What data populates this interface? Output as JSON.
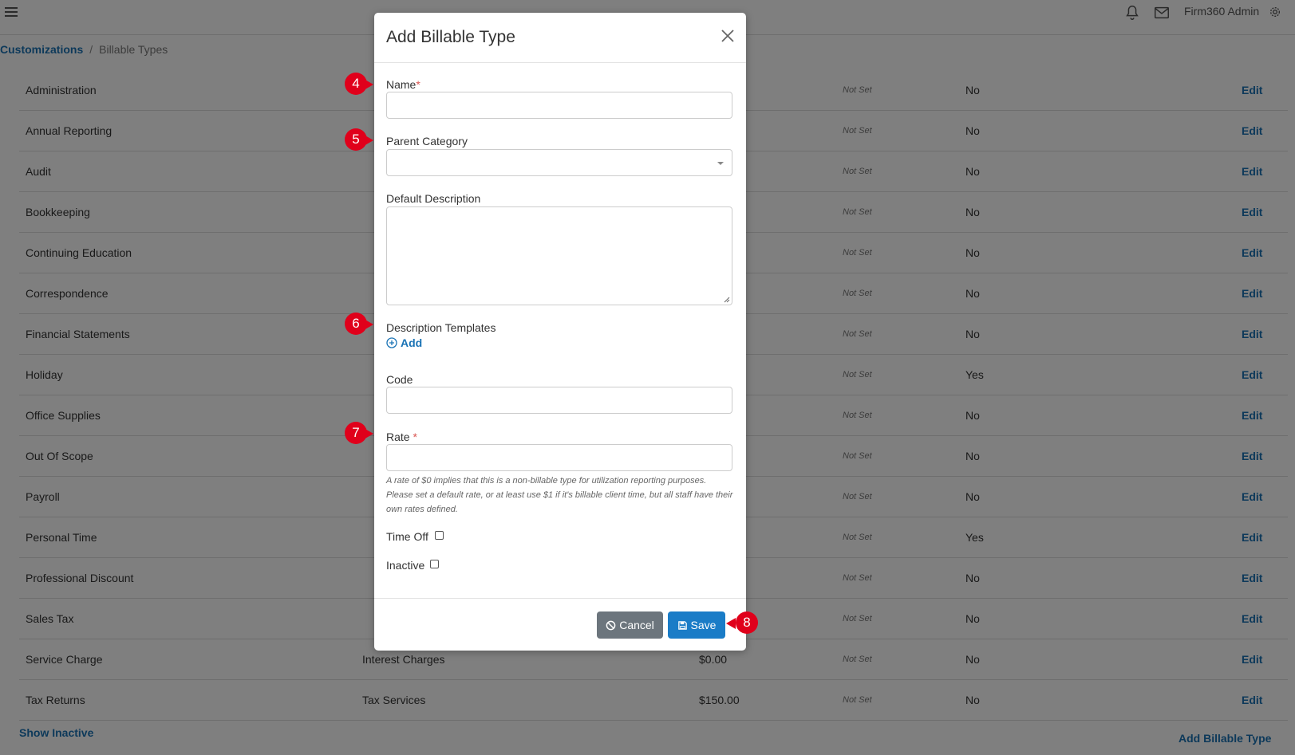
{
  "topbar": {
    "user": "Firm360 Admin",
    "icons": [
      "menu-icon",
      "bell-icon",
      "mail-icon",
      "gear-icon"
    ]
  },
  "breadcrumb": {
    "parent": "Customizations",
    "sep": "/",
    "current": "Billable Types"
  },
  "table": {
    "rows": [
      {
        "name": "Administration",
        "parent": "",
        "rate": "",
        "default": "Not Set",
        "time_off": "No",
        "action": "Edit"
      },
      {
        "name": "Annual Reporting",
        "parent": "",
        "rate": "",
        "default": "Not Set",
        "time_off": "No",
        "action": "Edit"
      },
      {
        "name": "Audit",
        "parent": "",
        "rate": "",
        "default": "Not Set",
        "time_off": "No",
        "action": "Edit"
      },
      {
        "name": "Bookkeeping",
        "parent": "",
        "rate": "",
        "default": "Not Set",
        "time_off": "No",
        "action": "Edit"
      },
      {
        "name": "Continuing Education",
        "parent": "",
        "rate": "",
        "default": "Not Set",
        "time_off": "No",
        "action": "Edit"
      },
      {
        "name": "Correspondence",
        "parent": "",
        "rate": "",
        "default": "Not Set",
        "time_off": "No",
        "action": "Edit"
      },
      {
        "name": "Financial Statements",
        "parent": "",
        "rate": "",
        "default": "Not Set",
        "time_off": "No",
        "action": "Edit"
      },
      {
        "name": "Holiday",
        "parent": "",
        "rate": "",
        "default": "Not Set",
        "time_off": "Yes",
        "action": "Edit"
      },
      {
        "name": "Office Supplies",
        "parent": "",
        "rate": "",
        "default": "Not Set",
        "time_off": "No",
        "action": "Edit"
      },
      {
        "name": "Out Of Scope",
        "parent": "",
        "rate": "",
        "default": "Not Set",
        "time_off": "No",
        "action": "Edit"
      },
      {
        "name": "Payroll",
        "parent": "",
        "rate": "",
        "default": "Not Set",
        "time_off": "No",
        "action": "Edit"
      },
      {
        "name": "Personal Time",
        "parent": "",
        "rate": "",
        "default": "Not Set",
        "time_off": "Yes",
        "action": "Edit"
      },
      {
        "name": "Professional Discount",
        "parent": "",
        "rate": "",
        "default": "Not Set",
        "time_off": "No",
        "action": "Edit"
      },
      {
        "name": "Sales Tax",
        "parent": "",
        "rate": "",
        "default": "Not Set",
        "time_off": "No",
        "action": "Edit"
      },
      {
        "name": "Service Charge",
        "parent": "Interest Charges",
        "rate": "$0.00",
        "default": "Not Set",
        "time_off": "No",
        "action": "Edit"
      },
      {
        "name": "Tax Returns",
        "parent": "Tax Services",
        "rate": "$150.00",
        "default": "Not Set",
        "time_off": "No",
        "action": "Edit"
      }
    ],
    "show_inactive": "Show Inactive",
    "add_button": "Add Billable Type"
  },
  "modal": {
    "title": "Add Billable Type",
    "name_label": "Name",
    "required_mark": "*",
    "parent_label": "Parent Category",
    "description_label": "Default Description",
    "templates_label": "Description Templates",
    "add_label": "Add",
    "code_label": "Code",
    "rate_label": "Rate",
    "rate_help": "A rate of $0 implies that this is a non-billable type for utilization reporting purposes. Please set a default rate, or at least use $1 if it's billable client time, but all staff have their own rates defined.",
    "time_off_label": "Time Off",
    "inactive_label": "Inactive",
    "cancel_label": "Cancel",
    "save_label": "Save"
  },
  "markers": [
    "4",
    "5",
    "6",
    "7",
    "8"
  ],
  "colors": {
    "accent": "#1a73b5",
    "marker": "#e0001b",
    "cancel": "#6c757d",
    "save": "#1a7cc7"
  }
}
